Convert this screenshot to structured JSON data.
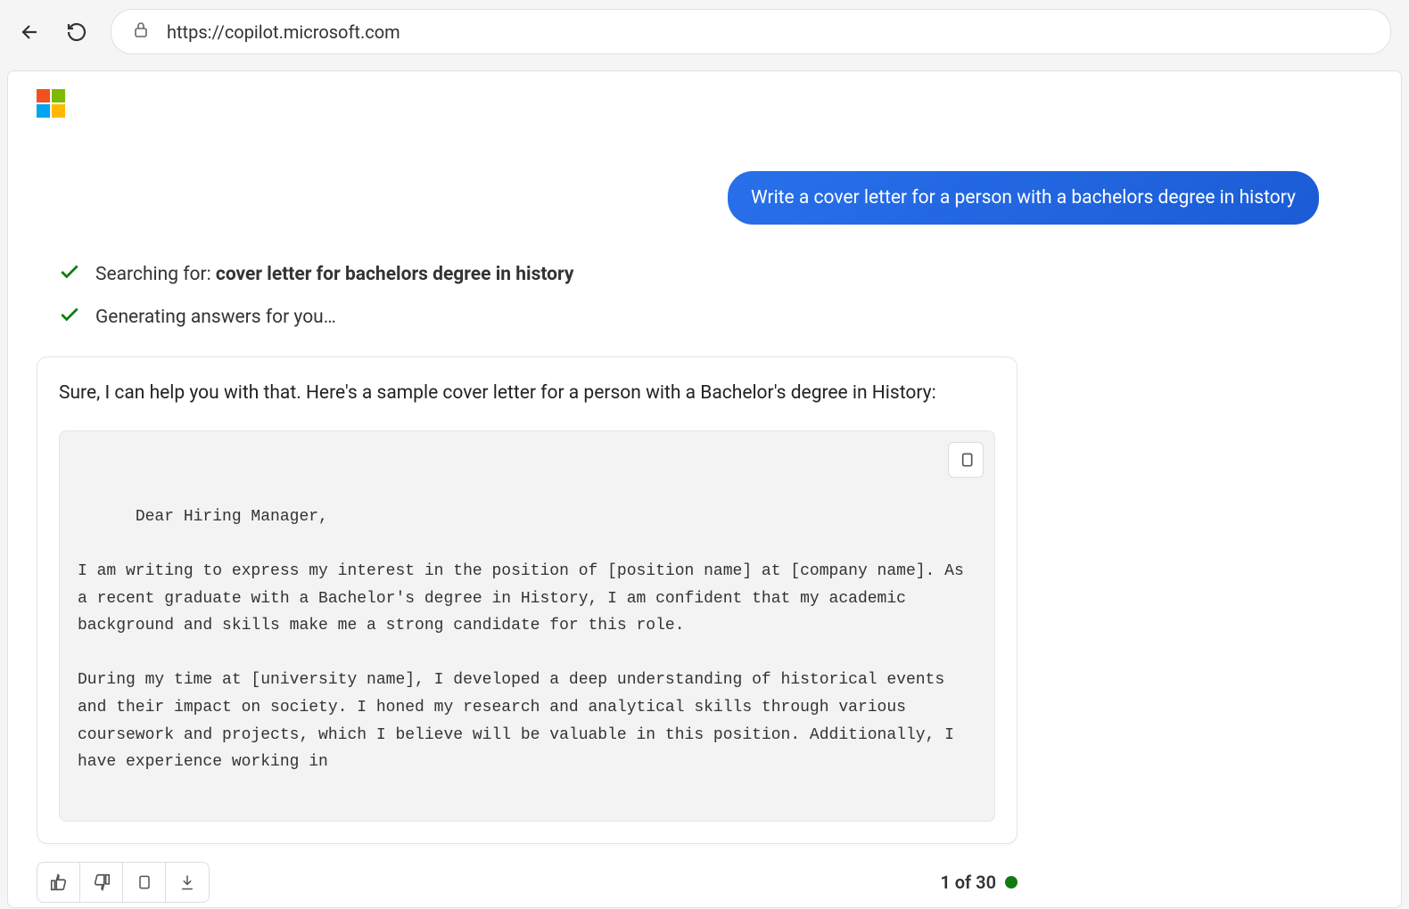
{
  "browser": {
    "url": "https://copilot.microsoft.com"
  },
  "conversation": {
    "user_message": "Write a cover letter for a person with a bachelors degree in history",
    "status1_label": "Searching for: ",
    "status1_bold": "cover letter for bachelors degree in history",
    "status2_label": "Generating answers for you…",
    "response_intro": "Sure, I can help you with that. Here's a sample cover letter for a person with a Bachelor's degree in History:",
    "code_content": "Dear Hiring Manager,\n\nI am writing to express my interest in the position of [position name] at [company name]. As a recent graduate with a Bachelor's degree in History, I am confident that my academic background and skills make me a strong candidate for this role.\n\nDuring my time at [university name], I developed a deep understanding of historical events and their impact on society. I honed my research and analytical skills through various coursework and projects, which I believe will be valuable in this position. Additionally, I have experience working in"
  },
  "footer": {
    "counter": "1 of 30"
  }
}
